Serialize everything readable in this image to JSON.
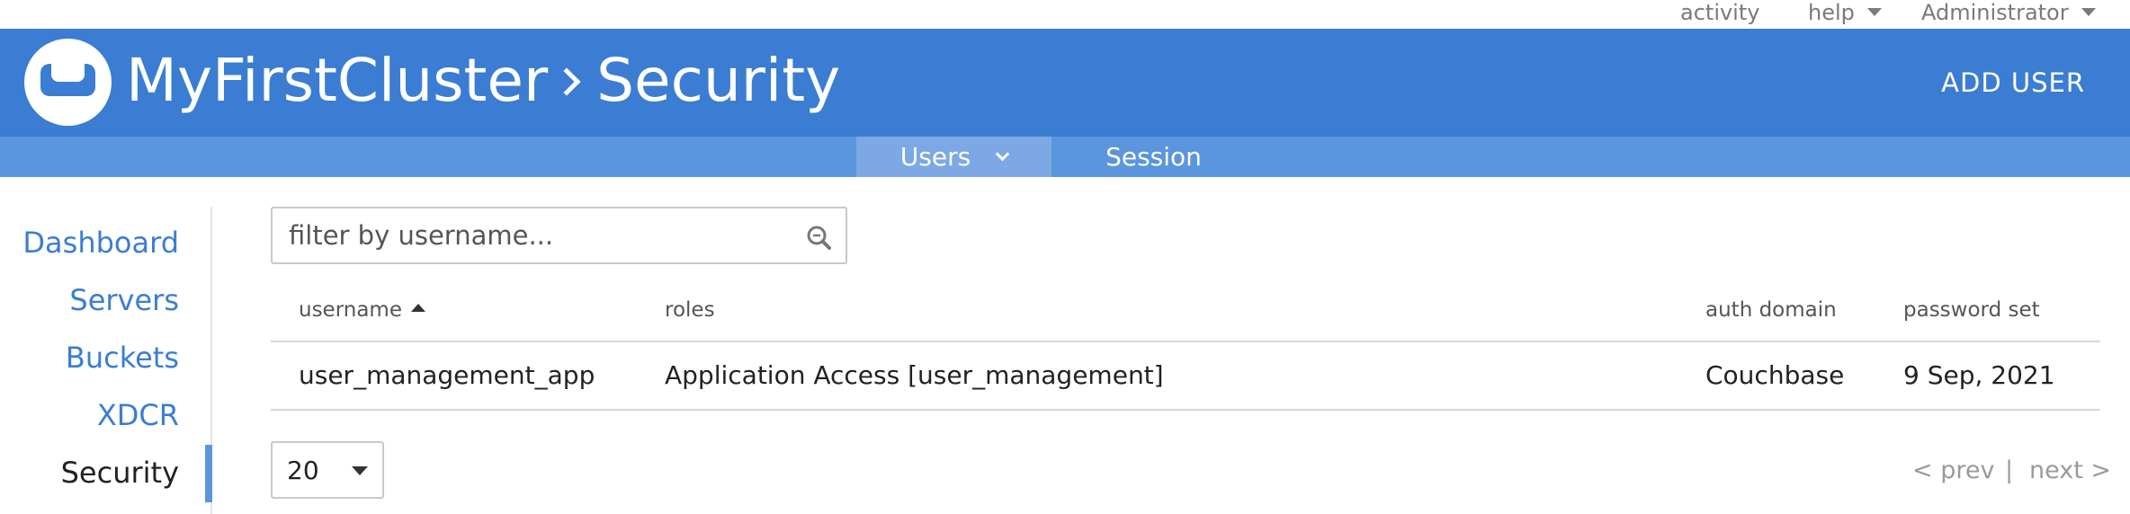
{
  "utility_bar": {
    "activity": "activity",
    "help": "help",
    "user": "Administrator"
  },
  "header": {
    "cluster_name": "MyFirstCluster",
    "section": "Security",
    "add_user_label": "ADD USER"
  },
  "subnav": {
    "tabs": [
      {
        "label": "Users",
        "active": true
      },
      {
        "label": "Session",
        "active": false
      }
    ]
  },
  "sidebar": {
    "items": [
      {
        "label": "Dashboard"
      },
      {
        "label": "Servers"
      },
      {
        "label": "Buckets"
      },
      {
        "label": "XDCR"
      },
      {
        "label": "Security",
        "active": true
      }
    ]
  },
  "filter": {
    "placeholder": "filter by username..."
  },
  "table": {
    "columns": {
      "username": "username",
      "roles": "roles",
      "auth_domain": "auth domain",
      "password_set": "password set"
    },
    "sort": {
      "column": "username",
      "direction": "ascending"
    },
    "rows": [
      {
        "username": "user_management_app",
        "roles": "Application Access [user_management]",
        "auth_domain": "Couchbase",
        "password_set": "9 Sep, 2021"
      }
    ]
  },
  "pager": {
    "page_size": "20",
    "prev": "< prev",
    "separator": "|",
    "next": "next >"
  },
  "colors": {
    "header_blue": "#3b7dd2",
    "subnav_blue": "#5b95de",
    "active_tab": "#7ca9e5",
    "link_blue": "#3b7dd2"
  }
}
